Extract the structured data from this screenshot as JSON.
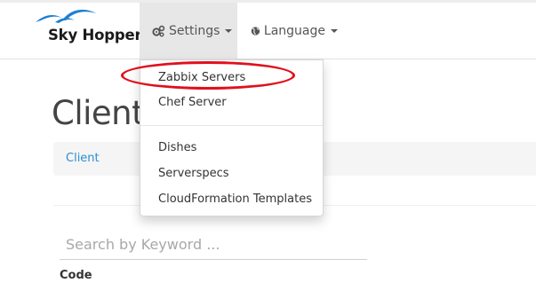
{
  "brand": {
    "name": "Sky Hopper",
    "logo_icon": "bird-wings-icon",
    "logo_color": "#1f7fd0"
  },
  "navbar": {
    "settings": {
      "label": "Settings",
      "icon": "gears-icon"
    },
    "language": {
      "label": "Language",
      "icon": "globe-icon"
    }
  },
  "settings_menu": {
    "items": [
      {
        "label": "Zabbix Servers"
      },
      {
        "label": "Chef Server"
      },
      {
        "label": "Dishes"
      },
      {
        "label": "Serverspecs"
      },
      {
        "label": "CloudFormation Templates"
      }
    ],
    "highlight_color": "#e0101c"
  },
  "main": {
    "page_title": "Client",
    "breadcrumb": {
      "label": "Client"
    },
    "search": {
      "placeholder": "Search by Keyword ..."
    },
    "table": {
      "columns": [
        "Code"
      ]
    }
  },
  "colors": {
    "link": "#2a8fd1",
    "active_nav_bg": "#e7e7e7"
  }
}
